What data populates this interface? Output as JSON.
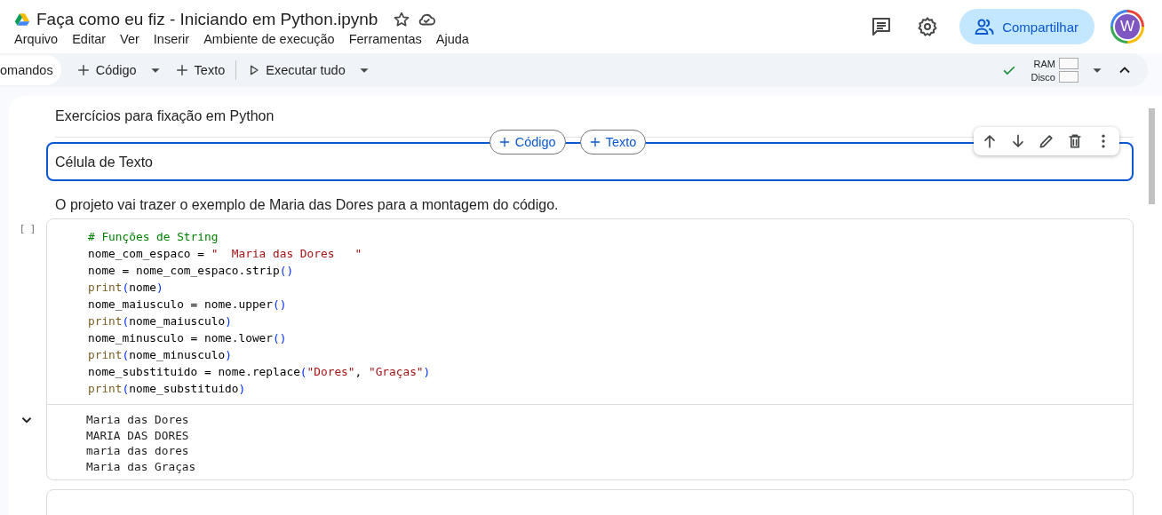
{
  "title": "Faça como eu fiz - Iniciando em Python.ipynb",
  "menu": [
    "Arquivo",
    "Editar",
    "Ver",
    "Inserir",
    "Ambiente de execução",
    "Ferramentas",
    "Ajuda"
  ],
  "share_label": "Compartilhar",
  "avatar_letter": "W",
  "toolbar": {
    "commands_label": "omandos",
    "add_code": "Código",
    "add_text": "Texto",
    "run_all": "Executar tudo"
  },
  "resources": {
    "connected": true,
    "ram_label": "RAM",
    "disk_label": "Disco"
  },
  "insert_buttons": {
    "code": "Código",
    "text": "Texto"
  },
  "cells": [
    {
      "kind": "text",
      "text": "Exercícios para fixação em Python",
      "selected": false
    },
    {
      "kind": "text",
      "text": "Célula de Texto",
      "selected": true
    },
    {
      "kind": "text",
      "text": "O projeto vai trazer o exemplo de Maria das Dores para a montagem do código.",
      "selected": false
    },
    {
      "kind": "code",
      "exec_label": "[ ]",
      "output_expanded": true,
      "lines": [
        [
          {
            "t": "# Funções de String",
            "kind": "comment"
          }
        ],
        [
          {
            "t": "nome_com_espaco = ",
            "kind": "plain"
          },
          {
            "t": "\"  Maria das Dores   \"",
            "kind": "string"
          }
        ],
        [
          {
            "t": "nome = nome_com_espaco.strip",
            "kind": "plain"
          },
          {
            "t": "()",
            "kind": "paren"
          }
        ],
        [
          {
            "t": "print",
            "kind": "builtin"
          },
          {
            "t": "(",
            "kind": "paren"
          },
          {
            "t": "nome",
            "kind": "plain"
          },
          {
            "t": ")",
            "kind": "paren"
          }
        ],
        [
          {
            "t": "nome_maiusculo = nome.upper",
            "kind": "plain"
          },
          {
            "t": "()",
            "kind": "paren"
          }
        ],
        [
          {
            "t": "print",
            "kind": "builtin"
          },
          {
            "t": "(",
            "kind": "paren"
          },
          {
            "t": "nome_maiusculo",
            "kind": "plain"
          },
          {
            "t": ")",
            "kind": "paren"
          }
        ],
        [
          {
            "t": "nome_minusculo = nome.lower",
            "kind": "plain"
          },
          {
            "t": "()",
            "kind": "paren"
          }
        ],
        [
          {
            "t": "print",
            "kind": "builtin"
          },
          {
            "t": "(",
            "kind": "paren"
          },
          {
            "t": "nome_minusculo",
            "kind": "plain"
          },
          {
            "t": ")",
            "kind": "paren"
          }
        ],
        [
          {
            "t": "nome_substituido = nome.replace",
            "kind": "plain"
          },
          {
            "t": "(",
            "kind": "paren"
          },
          {
            "t": "\"Dores\"",
            "kind": "string"
          },
          {
            "t": ", ",
            "kind": "plain"
          },
          {
            "t": "\"Graças\"",
            "kind": "string"
          },
          {
            "t": ")",
            "kind": "paren"
          }
        ],
        [
          {
            "t": "print",
            "kind": "builtin"
          },
          {
            "t": "(",
            "kind": "paren"
          },
          {
            "t": "nome_substituido",
            "kind": "plain"
          },
          {
            "t": ")",
            "kind": "paren"
          }
        ]
      ],
      "output": [
        "Maria das Dores",
        "MARIA DAS DORES",
        "maria das dores",
        "Maria das Graças"
      ]
    },
    {
      "kind": "code_stub"
    }
  ]
}
